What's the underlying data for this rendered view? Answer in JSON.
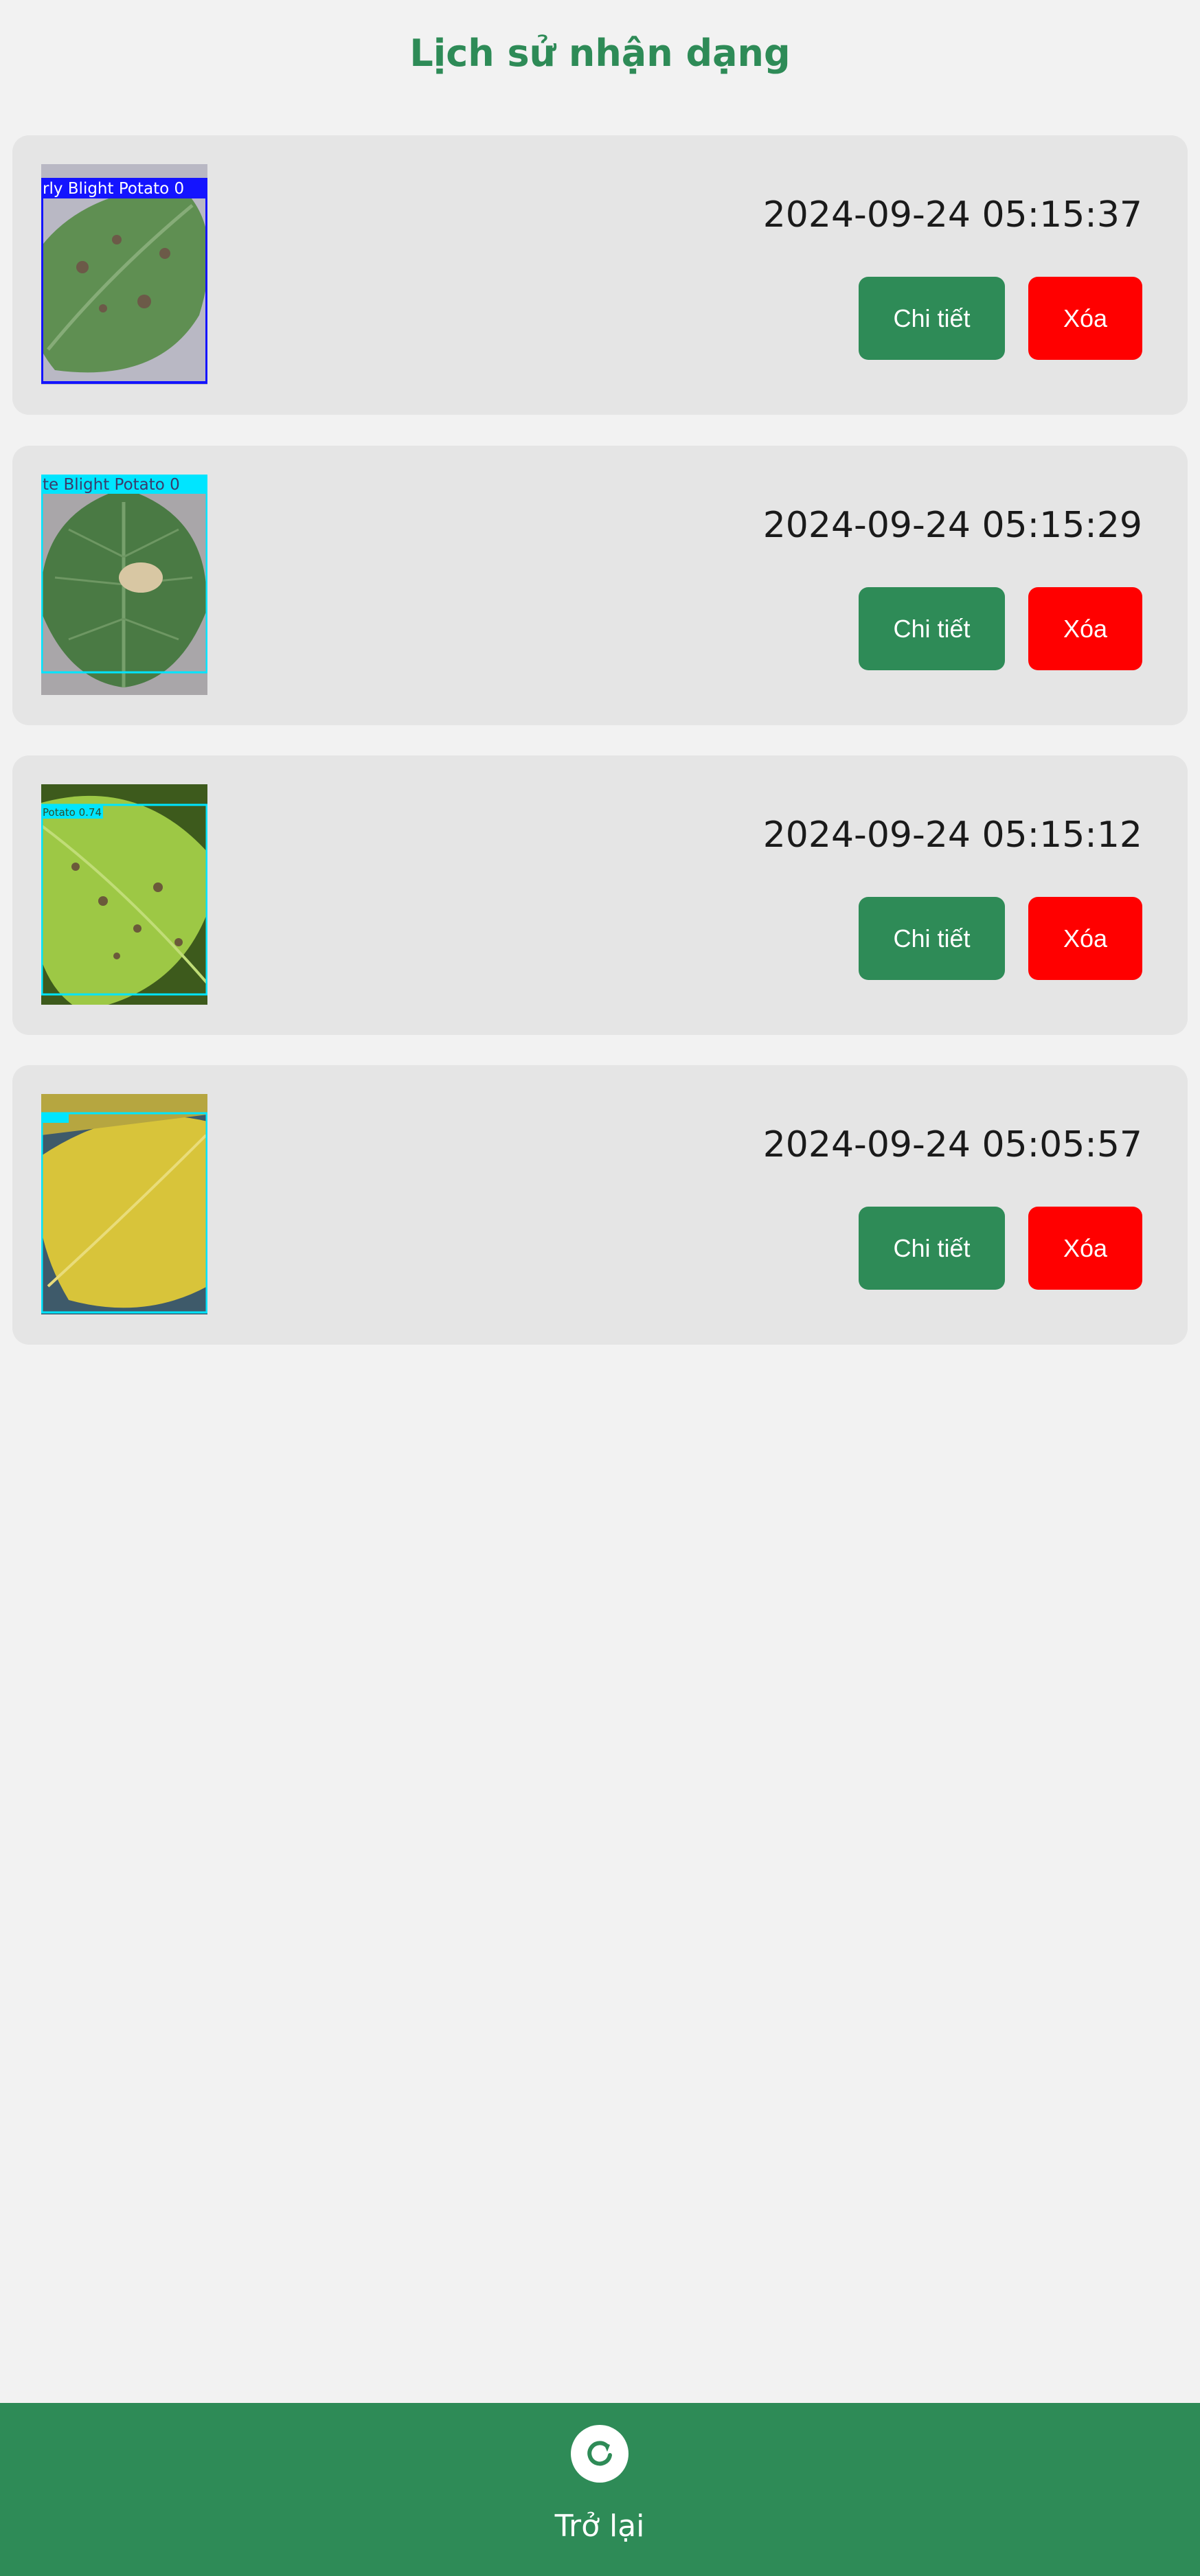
{
  "header": {
    "title": "Lịch sử nhận dạng"
  },
  "history": [
    {
      "timestamp": "2024-09-24 05:15:37",
      "image_label": "rly Blight Potato 0",
      "detail_label": "Chi tiết",
      "delete_label": "Xóa"
    },
    {
      "timestamp": "2024-09-24 05:15:29",
      "image_label": "te Blight Potato 0",
      "detail_label": "Chi tiết",
      "delete_label": "Xóa"
    },
    {
      "timestamp": "2024-09-24 05:15:12",
      "image_label": "Potato 0.74",
      "detail_label": "Chi tiết",
      "delete_label": "Xóa"
    },
    {
      "timestamp": "2024-09-24 05:05:57",
      "image_label": "",
      "detail_label": "Chi tiết",
      "delete_label": "Xóa"
    }
  ],
  "footer": {
    "back_label": "Trở lại",
    "back_icon": "refresh-icon"
  },
  "colors": {
    "primary": "#2e8b57",
    "danger": "#ff0000",
    "card_bg": "#e5e5e5",
    "page_bg": "#f2f2f2"
  }
}
